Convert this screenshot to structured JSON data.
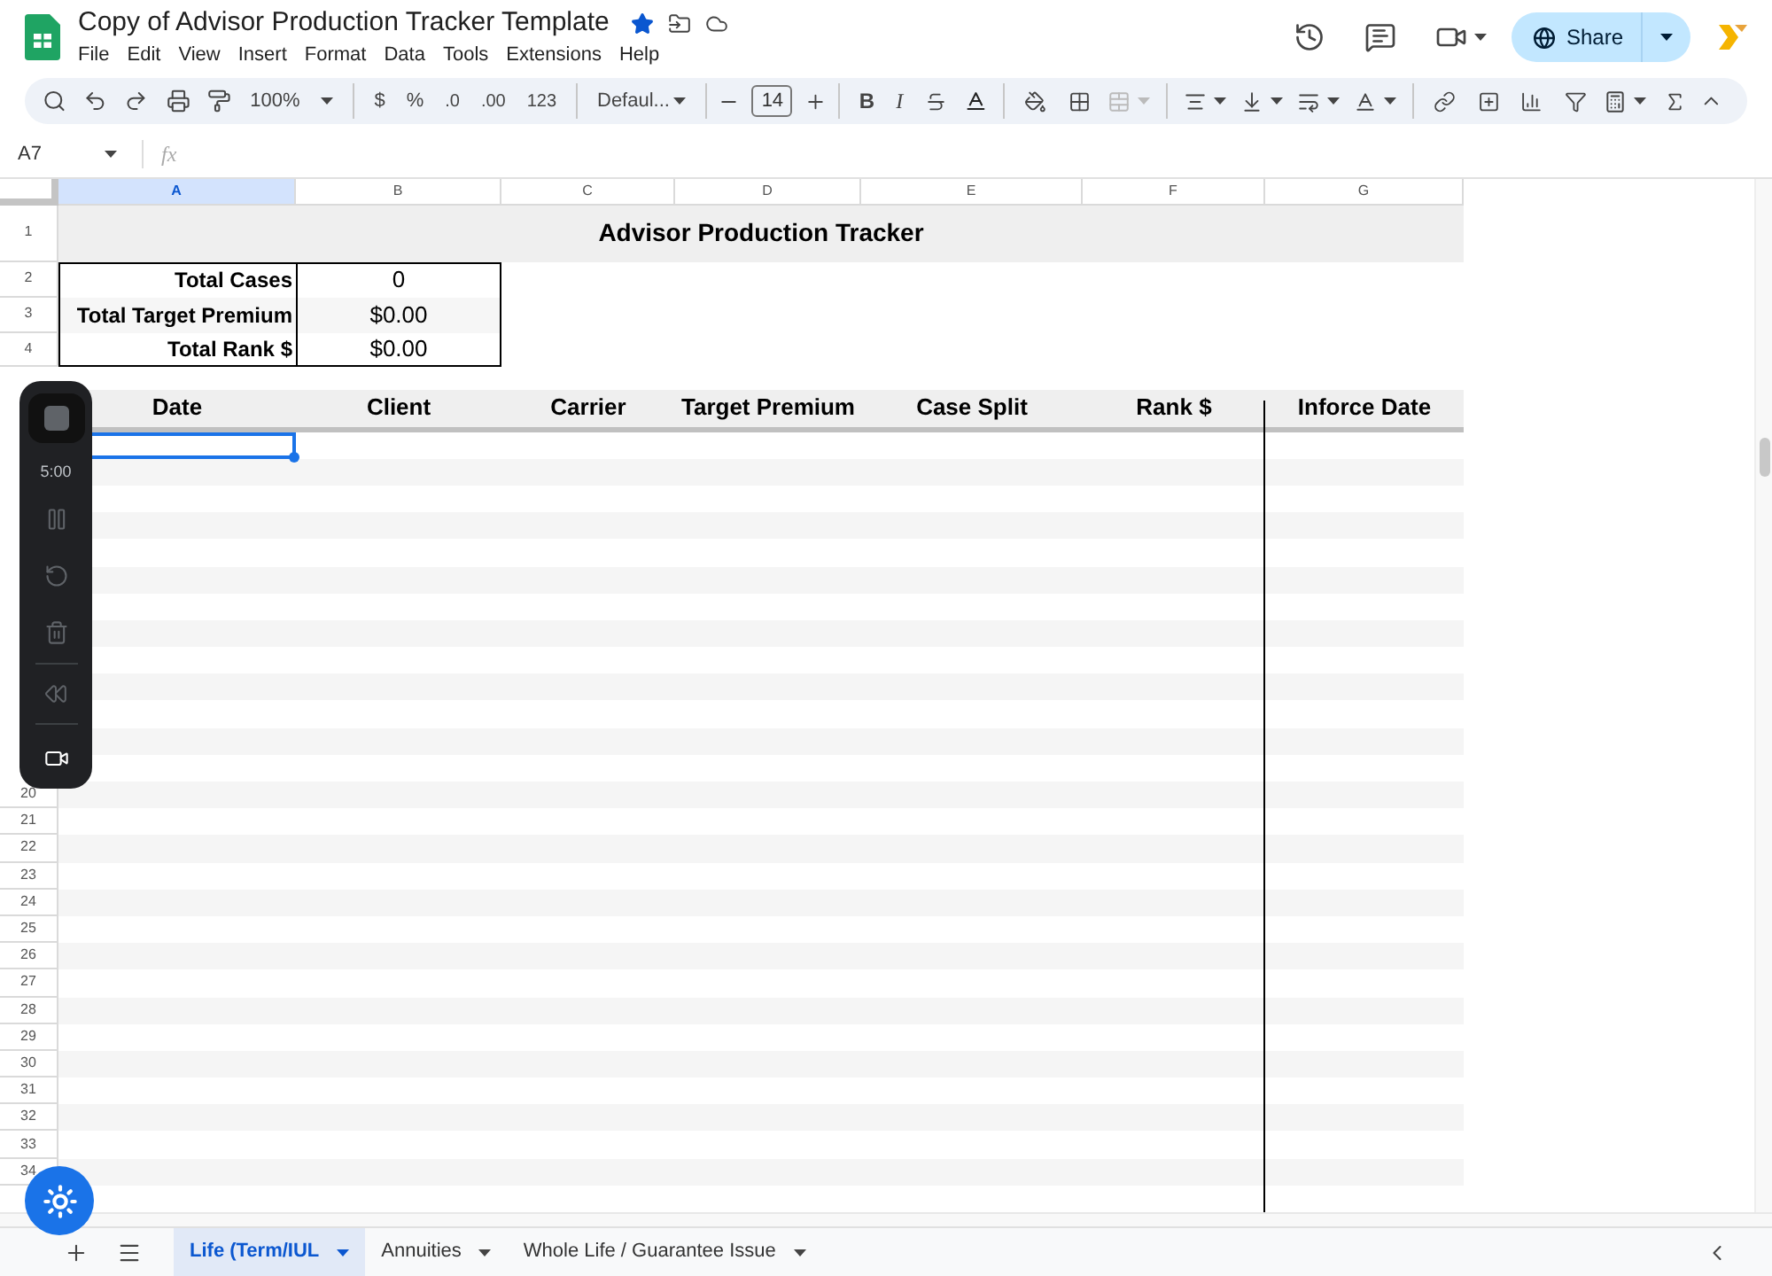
{
  "document": {
    "title": "Copy of Advisor Production Tracker Template",
    "starred": true
  },
  "menu": [
    "File",
    "Edit",
    "View",
    "Insert",
    "Format",
    "Data",
    "Tools",
    "Extensions",
    "Help"
  ],
  "share_button": "Share",
  "toolbar": {
    "zoom": "100%",
    "currency": "$",
    "percent": "%",
    "decrease_decimal": ".0",
    "increase_decimal": ".00",
    "number_format": "123",
    "font": "Defaul...",
    "font_size": "14",
    "bold": "B",
    "italic": "I"
  },
  "name_box": "A7",
  "formula_label": "fx",
  "columns": [
    {
      "label": "A",
      "selected": true
    },
    {
      "label": "B",
      "selected": false
    },
    {
      "label": "C",
      "selected": false
    },
    {
      "label": "D",
      "selected": false
    },
    {
      "label": "E",
      "selected": false
    },
    {
      "label": "F",
      "selected": false
    },
    {
      "label": "G",
      "selected": false
    }
  ],
  "row_numbers": [
    "1",
    "2",
    "3",
    "4",
    "20",
    "21",
    "22",
    "23",
    "24",
    "25",
    "26",
    "27",
    "28",
    "29",
    "30",
    "31",
    "32",
    "33",
    "34"
  ],
  "sheet": {
    "title": "Advisor Production Tracker",
    "summary": [
      {
        "label": "Total Cases",
        "value": "0"
      },
      {
        "label": "Total Target Premium",
        "value": "$0.00"
      },
      {
        "label": "Total Rank $",
        "value": "$0.00"
      }
    ],
    "headers": [
      "Date",
      "Client",
      "Carrier",
      "Target Premium",
      "Case Split",
      "Rank $",
      "Inforce Date"
    ]
  },
  "recorder": {
    "timer": "5:00"
  },
  "sheet_tabs": [
    {
      "label": "Life (Term/IUL",
      "selected": true
    },
    {
      "label": "Annuities",
      "selected": false
    },
    {
      "label": "Whole Life / Guarantee Issue",
      "selected": false
    }
  ]
}
